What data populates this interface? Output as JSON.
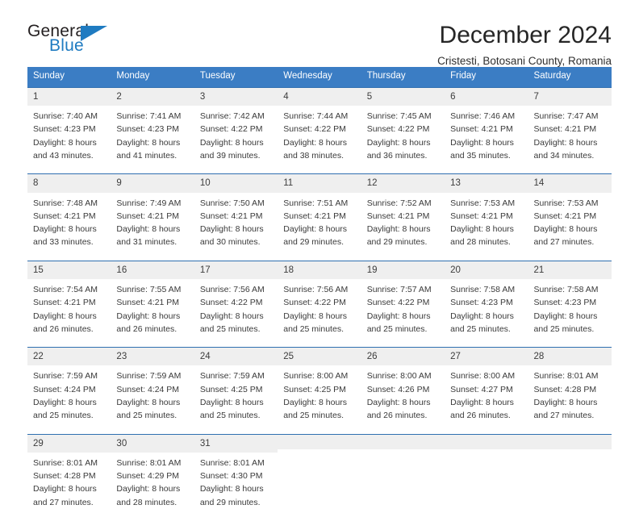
{
  "brand": {
    "name_top": "General",
    "name_bottom": "Blue",
    "color_blue": "#1f7bc1",
    "color_dark": "#231f20"
  },
  "header": {
    "title": "December 2024",
    "subtitle": "Cristesti, Botosani County, Romania"
  },
  "theme": {
    "header_blue": "#3b7dc4",
    "row_divider": "#2f6fb0",
    "day_number_band": "#efefef"
  },
  "weekdays": [
    "Sunday",
    "Monday",
    "Tuesday",
    "Wednesday",
    "Thursday",
    "Friday",
    "Saturday"
  ],
  "weeks": [
    [
      {
        "day": "1",
        "sunrise": "Sunrise: 7:40 AM",
        "sunset": "Sunset: 4:23 PM",
        "daylight1": "Daylight: 8 hours",
        "daylight2": "and 43 minutes."
      },
      {
        "day": "2",
        "sunrise": "Sunrise: 7:41 AM",
        "sunset": "Sunset: 4:23 PM",
        "daylight1": "Daylight: 8 hours",
        "daylight2": "and 41 minutes."
      },
      {
        "day": "3",
        "sunrise": "Sunrise: 7:42 AM",
        "sunset": "Sunset: 4:22 PM",
        "daylight1": "Daylight: 8 hours",
        "daylight2": "and 39 minutes."
      },
      {
        "day": "4",
        "sunrise": "Sunrise: 7:44 AM",
        "sunset": "Sunset: 4:22 PM",
        "daylight1": "Daylight: 8 hours",
        "daylight2": "and 38 minutes."
      },
      {
        "day": "5",
        "sunrise": "Sunrise: 7:45 AM",
        "sunset": "Sunset: 4:22 PM",
        "daylight1": "Daylight: 8 hours",
        "daylight2": "and 36 minutes."
      },
      {
        "day": "6",
        "sunrise": "Sunrise: 7:46 AM",
        "sunset": "Sunset: 4:21 PM",
        "daylight1": "Daylight: 8 hours",
        "daylight2": "and 35 minutes."
      },
      {
        "day": "7",
        "sunrise": "Sunrise: 7:47 AM",
        "sunset": "Sunset: 4:21 PM",
        "daylight1": "Daylight: 8 hours",
        "daylight2": "and 34 minutes."
      }
    ],
    [
      {
        "day": "8",
        "sunrise": "Sunrise: 7:48 AM",
        "sunset": "Sunset: 4:21 PM",
        "daylight1": "Daylight: 8 hours",
        "daylight2": "and 33 minutes."
      },
      {
        "day": "9",
        "sunrise": "Sunrise: 7:49 AM",
        "sunset": "Sunset: 4:21 PM",
        "daylight1": "Daylight: 8 hours",
        "daylight2": "and 31 minutes."
      },
      {
        "day": "10",
        "sunrise": "Sunrise: 7:50 AM",
        "sunset": "Sunset: 4:21 PM",
        "daylight1": "Daylight: 8 hours",
        "daylight2": "and 30 minutes."
      },
      {
        "day": "11",
        "sunrise": "Sunrise: 7:51 AM",
        "sunset": "Sunset: 4:21 PM",
        "daylight1": "Daylight: 8 hours",
        "daylight2": "and 29 minutes."
      },
      {
        "day": "12",
        "sunrise": "Sunrise: 7:52 AM",
        "sunset": "Sunset: 4:21 PM",
        "daylight1": "Daylight: 8 hours",
        "daylight2": "and 29 minutes."
      },
      {
        "day": "13",
        "sunrise": "Sunrise: 7:53 AM",
        "sunset": "Sunset: 4:21 PM",
        "daylight1": "Daylight: 8 hours",
        "daylight2": "and 28 minutes."
      },
      {
        "day": "14",
        "sunrise": "Sunrise: 7:53 AM",
        "sunset": "Sunset: 4:21 PM",
        "daylight1": "Daylight: 8 hours",
        "daylight2": "and 27 minutes."
      }
    ],
    [
      {
        "day": "15",
        "sunrise": "Sunrise: 7:54 AM",
        "sunset": "Sunset: 4:21 PM",
        "daylight1": "Daylight: 8 hours",
        "daylight2": "and 26 minutes."
      },
      {
        "day": "16",
        "sunrise": "Sunrise: 7:55 AM",
        "sunset": "Sunset: 4:21 PM",
        "daylight1": "Daylight: 8 hours",
        "daylight2": "and 26 minutes."
      },
      {
        "day": "17",
        "sunrise": "Sunrise: 7:56 AM",
        "sunset": "Sunset: 4:22 PM",
        "daylight1": "Daylight: 8 hours",
        "daylight2": "and 25 minutes."
      },
      {
        "day": "18",
        "sunrise": "Sunrise: 7:56 AM",
        "sunset": "Sunset: 4:22 PM",
        "daylight1": "Daylight: 8 hours",
        "daylight2": "and 25 minutes."
      },
      {
        "day": "19",
        "sunrise": "Sunrise: 7:57 AM",
        "sunset": "Sunset: 4:22 PM",
        "daylight1": "Daylight: 8 hours",
        "daylight2": "and 25 minutes."
      },
      {
        "day": "20",
        "sunrise": "Sunrise: 7:58 AM",
        "sunset": "Sunset: 4:23 PM",
        "daylight1": "Daylight: 8 hours",
        "daylight2": "and 25 minutes."
      },
      {
        "day": "21",
        "sunrise": "Sunrise: 7:58 AM",
        "sunset": "Sunset: 4:23 PM",
        "daylight1": "Daylight: 8 hours",
        "daylight2": "and 25 minutes."
      }
    ],
    [
      {
        "day": "22",
        "sunrise": "Sunrise: 7:59 AM",
        "sunset": "Sunset: 4:24 PM",
        "daylight1": "Daylight: 8 hours",
        "daylight2": "and 25 minutes."
      },
      {
        "day": "23",
        "sunrise": "Sunrise: 7:59 AM",
        "sunset": "Sunset: 4:24 PM",
        "daylight1": "Daylight: 8 hours",
        "daylight2": "and 25 minutes."
      },
      {
        "day": "24",
        "sunrise": "Sunrise: 7:59 AM",
        "sunset": "Sunset: 4:25 PM",
        "daylight1": "Daylight: 8 hours",
        "daylight2": "and 25 minutes."
      },
      {
        "day": "25",
        "sunrise": "Sunrise: 8:00 AM",
        "sunset": "Sunset: 4:25 PM",
        "daylight1": "Daylight: 8 hours",
        "daylight2": "and 25 minutes."
      },
      {
        "day": "26",
        "sunrise": "Sunrise: 8:00 AM",
        "sunset": "Sunset: 4:26 PM",
        "daylight1": "Daylight: 8 hours",
        "daylight2": "and 26 minutes."
      },
      {
        "day": "27",
        "sunrise": "Sunrise: 8:00 AM",
        "sunset": "Sunset: 4:27 PM",
        "daylight1": "Daylight: 8 hours",
        "daylight2": "and 26 minutes."
      },
      {
        "day": "28",
        "sunrise": "Sunrise: 8:01 AM",
        "sunset": "Sunset: 4:28 PM",
        "daylight1": "Daylight: 8 hours",
        "daylight2": "and 27 minutes."
      }
    ],
    [
      {
        "day": "29",
        "sunrise": "Sunrise: 8:01 AM",
        "sunset": "Sunset: 4:28 PM",
        "daylight1": "Daylight: 8 hours",
        "daylight2": "and 27 minutes."
      },
      {
        "day": "30",
        "sunrise": "Sunrise: 8:01 AM",
        "sunset": "Sunset: 4:29 PM",
        "daylight1": "Daylight: 8 hours",
        "daylight2": "and 28 minutes."
      },
      {
        "day": "31",
        "sunrise": "Sunrise: 8:01 AM",
        "sunset": "Sunset: 4:30 PM",
        "daylight1": "Daylight: 8 hours",
        "daylight2": "and 29 minutes."
      },
      {
        "day": "",
        "sunrise": "",
        "sunset": "",
        "daylight1": "",
        "daylight2": ""
      },
      {
        "day": "",
        "sunrise": "",
        "sunset": "",
        "daylight1": "",
        "daylight2": ""
      },
      {
        "day": "",
        "sunrise": "",
        "sunset": "",
        "daylight1": "",
        "daylight2": ""
      },
      {
        "day": "",
        "sunrise": "",
        "sunset": "",
        "daylight1": "",
        "daylight2": ""
      }
    ]
  ]
}
